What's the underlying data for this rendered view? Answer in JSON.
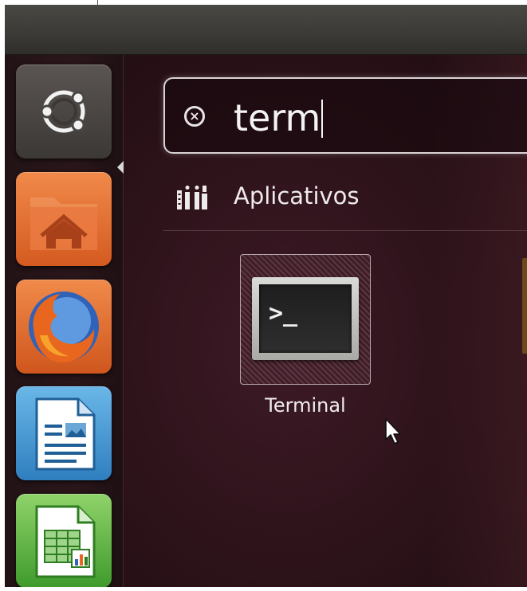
{
  "launcher": {
    "items": [
      {
        "name": "Dash home",
        "icon": "ubuntu-logo-icon"
      },
      {
        "name": "Home folder",
        "icon": "home-folder-icon"
      },
      {
        "name": "Firefox",
        "icon": "firefox-icon"
      },
      {
        "name": "LibreOffice Writer",
        "icon": "writer-document-icon"
      },
      {
        "name": "LibreOffice Calc",
        "icon": "calc-spreadsheet-icon"
      }
    ]
  },
  "search": {
    "query": "term",
    "clear_icon": "clear-search-icon"
  },
  "category": {
    "label": "Aplicativos",
    "icon": "applications-category-icon"
  },
  "results": [
    {
      "label": "Terminal",
      "icon": "terminal-icon",
      "prompt": ">_"
    }
  ],
  "colors": {
    "dash_background": "#2c1219",
    "launcher_background": "#221316",
    "panel": "#3b3a36",
    "text": "#f4f2f2",
    "home_tile": "#e06a2d",
    "writer_tile": "#3a8fd0",
    "calc_tile": "#5cb83e"
  }
}
